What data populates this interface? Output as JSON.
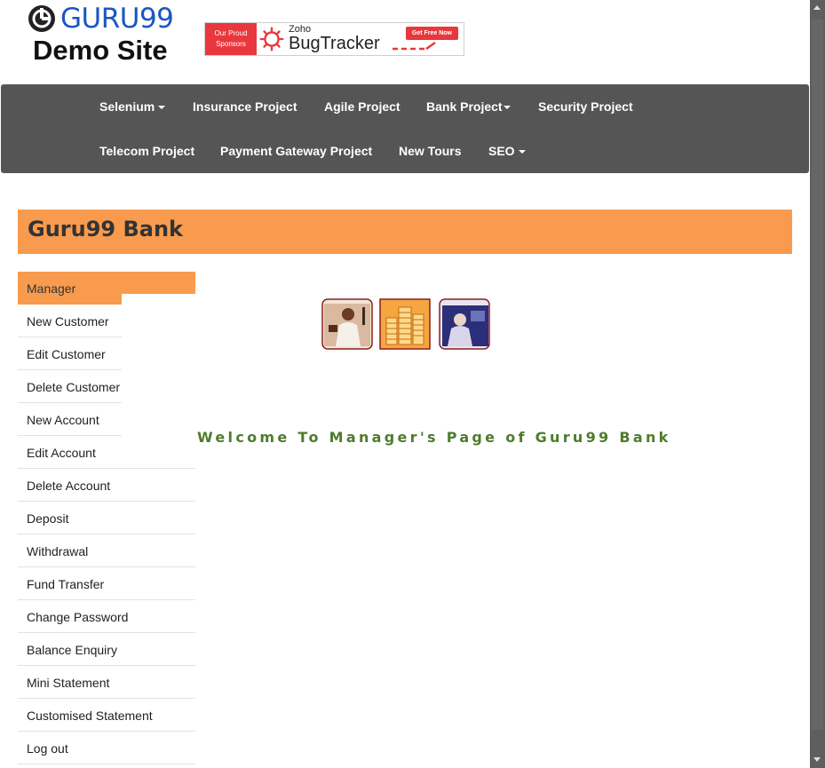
{
  "logo": {
    "brand": "GURU99",
    "subtitle": "Demo Site",
    "icon": "guru99-logo-icon"
  },
  "ad": {
    "left_text_1": "Our Proud",
    "left_text_2": "Sponsors",
    "brand_small": "Zoho",
    "brand_large": "BugTracker",
    "cta": "Get Free Now",
    "icon": "bug-gear-icon",
    "accent": "#e8383d"
  },
  "nav": {
    "items": [
      {
        "label": "Selenium",
        "dropdown": true
      },
      {
        "label": "Insurance Project",
        "dropdown": false
      },
      {
        "label": "Agile Project",
        "dropdown": false
      },
      {
        "label": "Bank Project",
        "dropdown": true
      },
      {
        "label": "Security Project",
        "dropdown": false
      },
      {
        "label": "Telecom Project",
        "dropdown": false
      },
      {
        "label": "Payment Gateway Project",
        "dropdown": false
      },
      {
        "label": "New Tours",
        "dropdown": false
      },
      {
        "label": "SEO",
        "dropdown": true
      }
    ],
    "background": "#555555"
  },
  "bank": {
    "title": "Guru99 Bank",
    "accent": "#f89b4e"
  },
  "sidebar": {
    "active": "Manager",
    "items": [
      "New Customer",
      "Edit Customer",
      "Delete Customer",
      "New Account",
      "Edit Account",
      "Delete Account",
      "Deposit",
      "Withdrawal",
      "Fund Transfer",
      "Change Password",
      "Balance Enquiry",
      "Mini Statement",
      "Customised Statement",
      "Log out"
    ]
  },
  "welcome": {
    "text": "Welcome To Manager's Page of Guru99 Bank",
    "color": "#4d7c2b"
  }
}
